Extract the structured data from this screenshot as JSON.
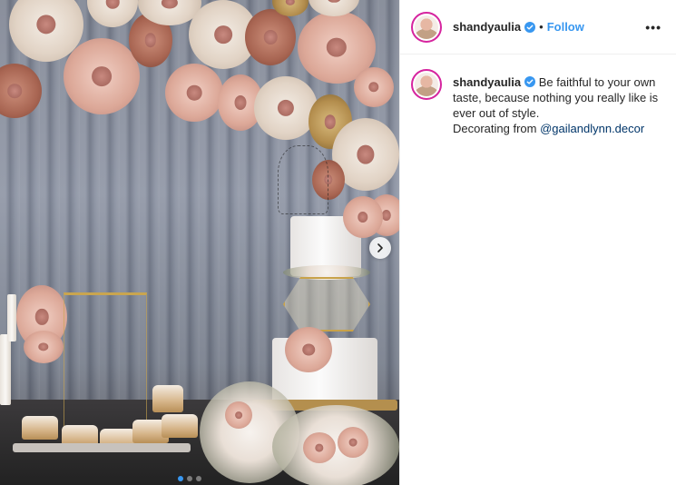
{
  "post": {
    "image": {
      "cake_topper_alt": "Wedding cake with flower backdrop",
      "carousel_dot_count": 3,
      "carousel_active_index": 0
    },
    "header": {
      "username": "shandyaulia",
      "separator": "•",
      "follow_label": "Follow",
      "more_label": "•••"
    },
    "caption": {
      "username": "shandyaulia",
      "line1": "Be faithful to your own taste, because nothing you really like is ever out of style.",
      "line2_prefix": "Decorating from ",
      "mention": "@gailandlynn.decor"
    },
    "colors": {
      "follow_blue": "#3897f0",
      "verified_blue": "#3897f0",
      "mention_navy": "#003569",
      "story_ring": "#d6249f"
    },
    "icons": {
      "verified": "verified-badge-icon",
      "next": "chevron-right-icon",
      "more": "more-options-icon"
    }
  }
}
